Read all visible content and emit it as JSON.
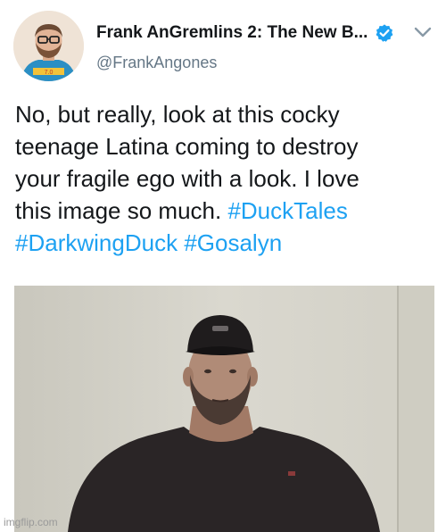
{
  "tweet": {
    "display_name": "Frank AnGremlins 2: The New B...",
    "handle": "@FrankAngones",
    "verified_icon": "verified-badge-icon",
    "menu_icon": "chevron-down-icon",
    "avatar_shirt_text": "7.0",
    "text_lines": [
      {
        "plain": "No, but really, look at this cocky",
        "tags": []
      },
      {
        "plain": "teenage Latina coming to destroy",
        "tags": []
      },
      {
        "plain": "your fragile ego with a look. I love",
        "tags": []
      },
      {
        "plain": "this image so much. ",
        "tags": [
          "#DuckTales"
        ]
      },
      {
        "plain": "",
        "tags": [
          "#DarkwingDuck",
          "#Gosalyn"
        ]
      }
    ]
  },
  "media": {
    "description_icon": "photo-man-in-cap"
  },
  "watermark": "imgflip.com",
  "colors": {
    "hashtag": "#1da1f2",
    "handle": "#657786",
    "verified": "#1da1f2"
  }
}
